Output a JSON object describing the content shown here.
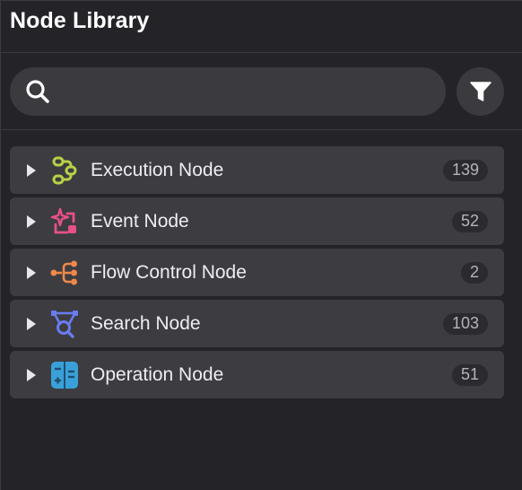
{
  "header": {
    "title": "Node Library"
  },
  "search": {
    "placeholder": ""
  },
  "categories": [
    {
      "label": "Execution Node",
      "count": "139",
      "icon": "execution-node-icon",
      "color": "#b7d246"
    },
    {
      "label": "Event Node",
      "count": "52",
      "icon": "event-node-icon",
      "color": "#e8508a"
    },
    {
      "label": "Flow Control Node",
      "count": "2",
      "icon": "flow-control-node-icon",
      "color": "#f0884a"
    },
    {
      "label": "Search Node",
      "count": "103",
      "icon": "search-node-icon",
      "color": "#6a7cf0"
    },
    {
      "label": "Operation Node",
      "count": "51",
      "icon": "operation-node-icon",
      "color": "#3aa0d8"
    }
  ]
}
